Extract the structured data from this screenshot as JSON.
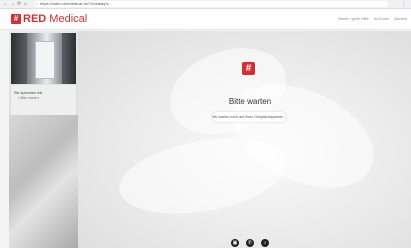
{
  "browser": {
    "back": "←",
    "forward": "→",
    "reload": "⟳",
    "home": "⌂",
    "url": "https://video.redmedical.de/?/media/pv..."
  },
  "header": {
    "logo_mark": "#",
    "logo_text_bold": "RED",
    "logo_text_rest": " Medical",
    "links": [
      "Bereit / gehe Hilfe",
      "Ihr Konto",
      "Abmeld"
    ]
  },
  "sidebar": {
    "title": "Sie sprechen mit",
    "subtitle": "Bitte warten..."
  },
  "main": {
    "logo_mark": "#",
    "wait_title": "Bitte warten",
    "wait_message": "Wir warten noch auf Ihren Gesprächspartner..."
  },
  "controls": [
    {
      "name": "camera",
      "glyph": "▣"
    },
    {
      "name": "phone",
      "glyph": "✆"
    },
    {
      "name": "microphone",
      "glyph": "♪"
    }
  ],
  "colors": {
    "brand_red": "#d42e2f"
  }
}
